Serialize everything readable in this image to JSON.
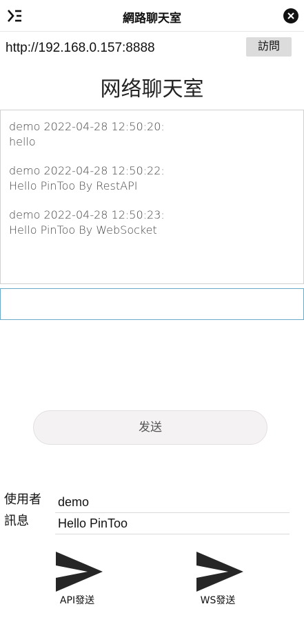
{
  "window": {
    "title": "網路聊天室",
    "menu_icon": "menu-icon",
    "close_icon": "close-icon"
  },
  "urlbar": {
    "url": "http://192.168.0.157:8888",
    "visit_label": "訪問"
  },
  "page": {
    "title": "网络聊天室"
  },
  "chat": {
    "messages": [
      {
        "meta": "demo 2022-04-28 12:50:20:",
        "text": "hello"
      },
      {
        "meta": "demo 2022-04-28 12:50:22:",
        "text": "Hello PinToo By RestAPI"
      },
      {
        "meta": "demo 2022-04-28 12:50:23:",
        "text": "Hello PinToo By WebSocket"
      }
    ]
  },
  "input": {
    "value": "",
    "placeholder": ""
  },
  "send_button": {
    "label": "发送"
  },
  "form": {
    "user_label": "使用者",
    "user_value": "demo",
    "message_label": "訊息",
    "message_value": "Hello PinToo"
  },
  "actions": {
    "api_send_label": "API發送",
    "ws_send_label": "WS發送",
    "icon": "send-arrow-icon"
  },
  "colors": {
    "accent_border": "#6aa9c7",
    "button_bg": "#dcdcdc",
    "icon": "#262626"
  }
}
